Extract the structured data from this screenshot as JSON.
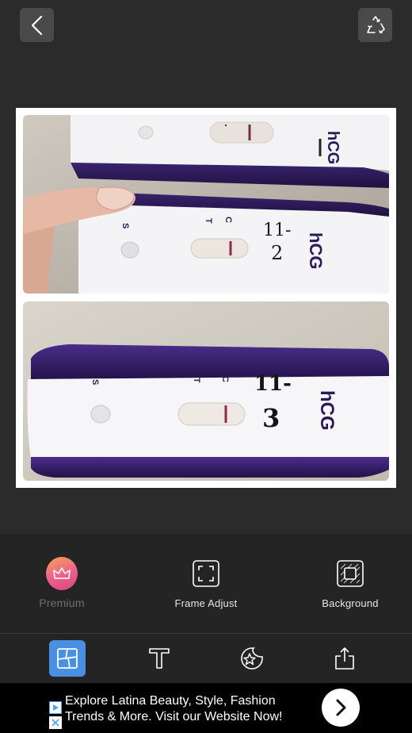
{
  "icons": {
    "back": "chevron-left-icon",
    "recycle": "recycle-icon",
    "premium": "crown-icon",
    "frame": "frame-adjust-icon",
    "background": "background-icon",
    "layout": "layout-icon",
    "text": "text-icon",
    "sticker": "sticker-icon",
    "share": "share-icon"
  },
  "collage": {
    "photos": [
      {
        "test_label": "hCG",
        "marker_lines": [
          "11-",
          "2"
        ],
        "window_letters": [
          "C",
          "T"
        ],
        "sample_letter": "S"
      },
      {
        "test_label": "hCG",
        "marker_lines": [
          "11-",
          "3"
        ],
        "window_letters": [
          "C",
          "T"
        ],
        "sample_letter": "S"
      }
    ]
  },
  "tools": {
    "premium_label": "Premium",
    "frame_label": "Frame Adjust",
    "background_label": "Background"
  },
  "ad": {
    "text": "Explore Latina Beauty, Style, Fashion Trends & More. Visit our Website Now!"
  },
  "colors": {
    "accent": "#4a90e2",
    "app_background": "#2b2b2b",
    "panel_background": "#242424",
    "premium_gradient_start": "#f7a05a",
    "premium_gradient_end": "#d8467f"
  }
}
